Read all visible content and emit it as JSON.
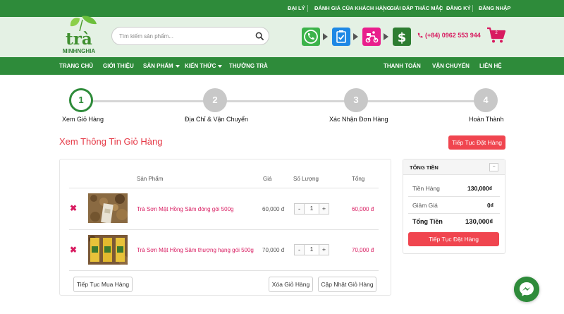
{
  "topbar": {
    "links": [
      "ĐẠI LÝ",
      "ĐÁNH GIÁ CỦA KHÁCH HÀNG",
      "GIẢI ĐÁP THẮC MẮC",
      "ĐĂNG KÝ",
      "ĐĂNG NHẬP"
    ]
  },
  "logo": {
    "text": "trà",
    "subtext": "MINHNGHIA"
  },
  "search": {
    "placeholder": "Tìm kiếm sản phẩm..."
  },
  "header": {
    "phone": "(+84) 0962 553 944",
    "cart_count": "2"
  },
  "nav": {
    "left": [
      "TRANG CHỦ",
      "GIỚI THIỆU",
      "SẢN PHẨM",
      "KIẾN THỨC",
      "THƯỞNG TRÀ"
    ],
    "right": [
      "THANH TOÁN",
      "VẬN CHUYỂN",
      "LIÊN HỆ"
    ]
  },
  "steps": [
    {
      "num": "1",
      "label": "Xem Giỏ Hàng"
    },
    {
      "num": "2",
      "label": "Địa Chỉ & Vận Chuyển"
    },
    {
      "num": "3",
      "label": "Xác Nhận Đơn Hàng"
    },
    {
      "num": "4",
      "label": "Hoàn Thành"
    }
  ],
  "page_title": "Xem Thông Tin Giỏ Hàng",
  "continue_order_button": "Tiếp Tục Đặt Hàng",
  "cart": {
    "headers": {
      "product": "Sản Phẩm",
      "price": "Giá",
      "qty": "Số Lượng",
      "total": "Tổng"
    },
    "rows": [
      {
        "name": "Trà Sơn Mật Hồng Sâm đóng gói 500g",
        "price": "60,000 đ",
        "qty": "1",
        "total": "60,000 đ"
      },
      {
        "name": "Trà Sơn Mật Hồng Sâm thượng hạng gói 500g",
        "price": "70,000 đ",
        "qty": "1",
        "total": "70,000 đ"
      }
    ],
    "continue_shopping": "Tiếp Tục Mua Hàng",
    "clear_cart": "Xóa Giỏ Hàng",
    "update_cart": "Cập Nhật Giỏ Hàng"
  },
  "summary": {
    "title": "TỔNG TIỀN",
    "subtotal_label": "Tiền Hàng",
    "subtotal": "130,000₫",
    "discount_label": "Giảm Giá",
    "discount": "0₫",
    "total_label": "Tổng Tiền",
    "total": "130,000₫",
    "button": "Tiếp Tục Đặt Hàng"
  },
  "colors": {
    "green": "#2e8b3a",
    "pink": "#d81b60",
    "red": "#f0454f",
    "header_bg": "#e4f1e4"
  },
  "icons": [
    "search-icon",
    "phone-icon",
    "clipboard-icon",
    "delivery-icon",
    "dollar-icon",
    "cart-icon",
    "minus-icon",
    "plus-icon",
    "messenger-icon"
  ]
}
